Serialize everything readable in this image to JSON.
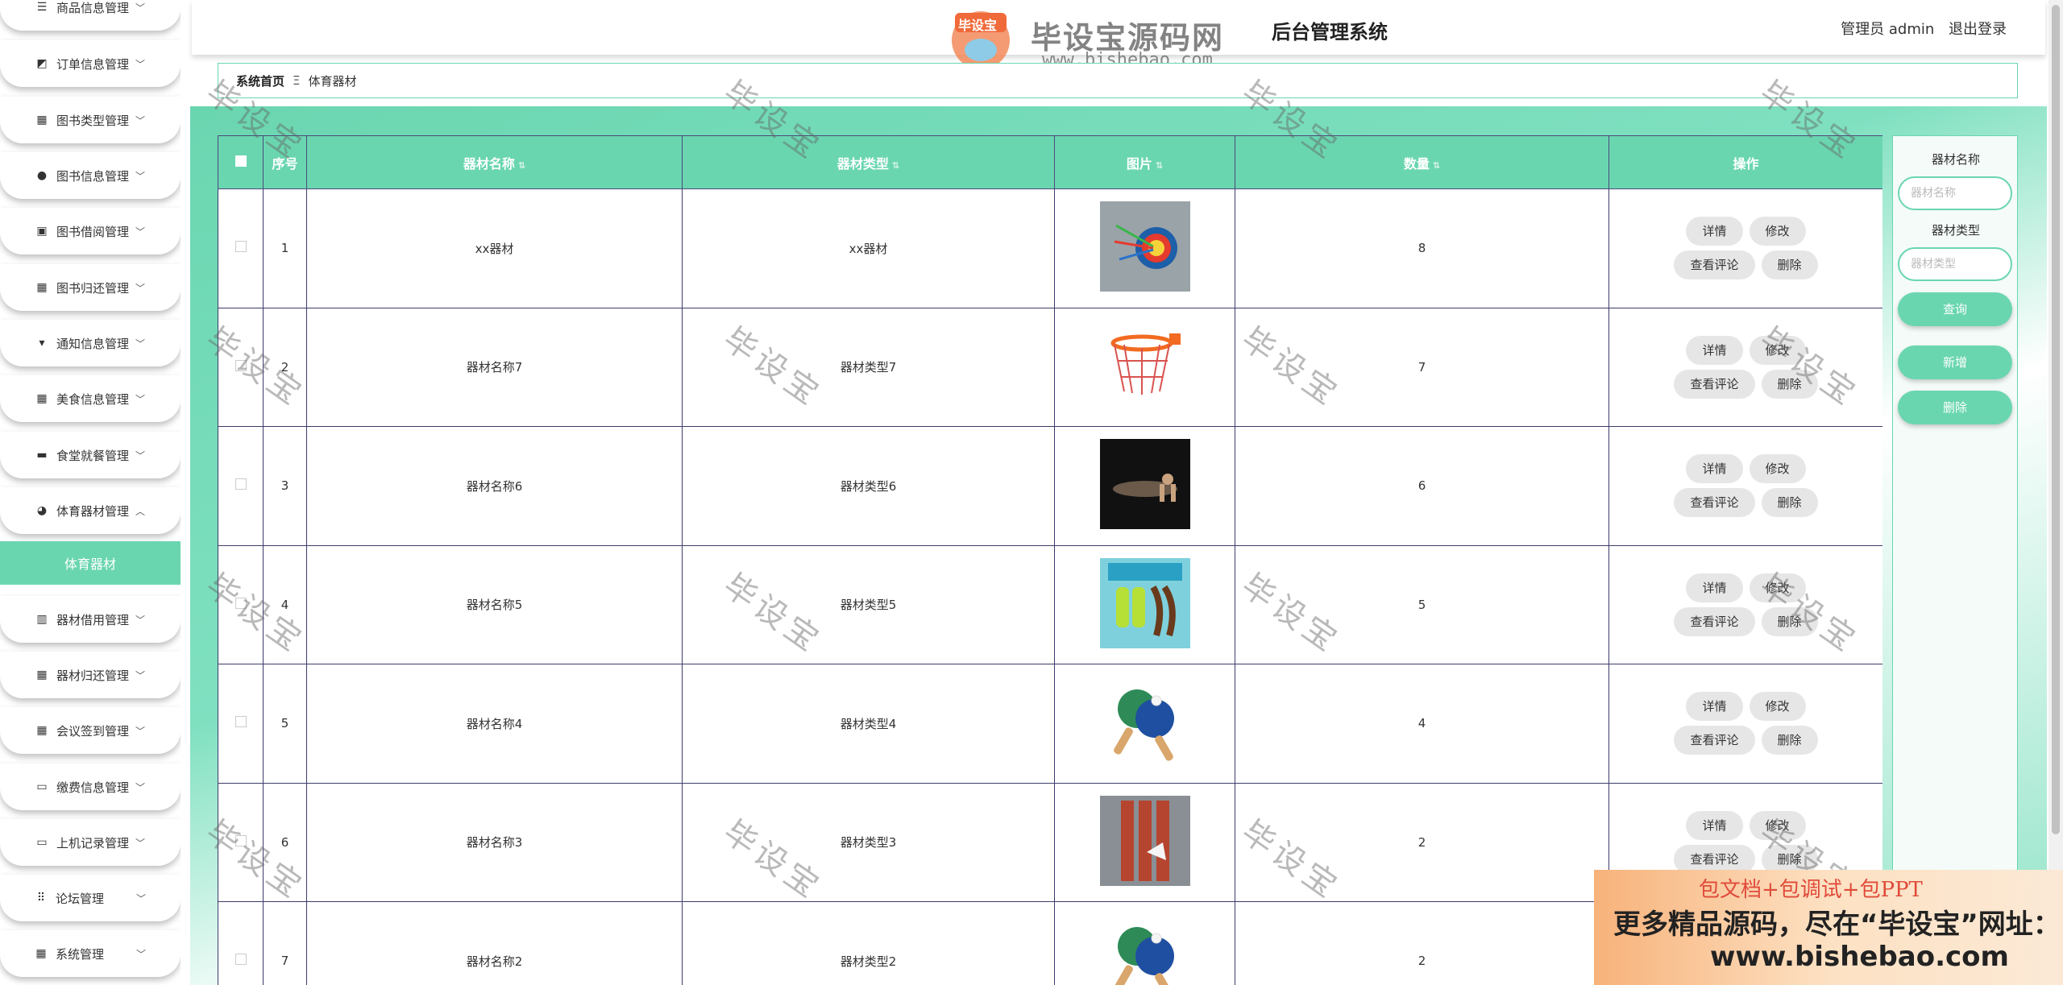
{
  "header": {
    "title": "后台管理系统",
    "user_label": "管理员 admin",
    "logout_label": "退出登录"
  },
  "logo": {
    "badge_text": "毕设宝",
    "main_text": "毕设宝源码网",
    "url_text": "www.bishebao.com"
  },
  "sidebar": {
    "items": [
      {
        "label": "商品信息管理",
        "icon": "list-icon"
      },
      {
        "label": "订单信息管理",
        "icon": "chart-icon"
      },
      {
        "label": "图书类型管理",
        "icon": "grid-icon"
      },
      {
        "label": "图书信息管理",
        "icon": "user-icon"
      },
      {
        "label": "图书借阅管理",
        "icon": "clipboard-icon"
      },
      {
        "label": "图书归还管理",
        "icon": "grid-icon"
      },
      {
        "label": "通知信息管理",
        "icon": "brush-icon"
      },
      {
        "label": "美食信息管理",
        "icon": "grid-icon"
      },
      {
        "label": "食堂就餐管理",
        "icon": "chat-icon"
      },
      {
        "label": "体育器材管理",
        "icon": "pin-icon"
      },
      {
        "label": "器材借用管理",
        "icon": "book-icon"
      },
      {
        "label": "器材归还管理",
        "icon": "grid-icon"
      },
      {
        "label": "会议签到管理",
        "icon": "grid-icon"
      },
      {
        "label": "缴费信息管理",
        "icon": "card-icon"
      },
      {
        "label": "上机记录管理",
        "icon": "monitor-icon"
      },
      {
        "label": "论坛管理",
        "icon": "dots-grid-icon"
      },
      {
        "label": "系统管理",
        "icon": "grid-icon"
      }
    ],
    "active_sub": "体育器材"
  },
  "breadcrumb": {
    "home": "系统首页",
    "separator": "Ξ",
    "current": "体育器材"
  },
  "table": {
    "headers": {
      "index": "序号",
      "name": "器材名称",
      "type": "器材类型",
      "image": "图片",
      "count": "数量",
      "actions": "操作"
    },
    "buttons": {
      "detail": "详情",
      "edit": "修改",
      "comments": "查看评论",
      "delete": "删除"
    },
    "rows": [
      {
        "index": "1",
        "name": "xx器材",
        "type": "xx器材",
        "count": "8",
        "image": "target-image"
      },
      {
        "index": "2",
        "name": "器材名称7",
        "type": "器材类型7",
        "count": "7",
        "image": "basketball-hoop-image"
      },
      {
        "index": "3",
        "name": "器材名称6",
        "type": "器材类型6",
        "count": "6",
        "image": "pushup-image"
      },
      {
        "index": "4",
        "name": "器材名称5",
        "type": "器材类型5",
        "count": "5",
        "image": "jump-rope-image"
      },
      {
        "index": "5",
        "name": "器材名称4",
        "type": "器材类型4",
        "count": "4",
        "image": "pingpong-paddle-image"
      },
      {
        "index": "6",
        "name": "器材名称3",
        "type": "器材类型3",
        "count": "2",
        "image": "badminton-tube-image"
      },
      {
        "index": "7",
        "name": "器材名称2",
        "type": "器材类型2",
        "count": "2",
        "image": "pingpong-paddle-image"
      }
    ]
  },
  "search": {
    "name_label": "器材名称",
    "name_placeholder": "器材名称",
    "type_label": "器材类型",
    "type_placeholder": "器材类型",
    "query_button": "查询",
    "add_button": "新增",
    "delete_button": "删除"
  },
  "ad": {
    "line1": "包文档+包调试+包PPT",
    "line2": "更多精品源码，尽在“毕设宝”网址：",
    "line3": "www.bishebao.com"
  },
  "watermark": {
    "text": "毕设宝"
  },
  "colors": {
    "accent": "#6ad6b0",
    "header_text": "#ffffff",
    "button_gray": "#e6e6e6",
    "ad_red": "#e04b3a"
  }
}
